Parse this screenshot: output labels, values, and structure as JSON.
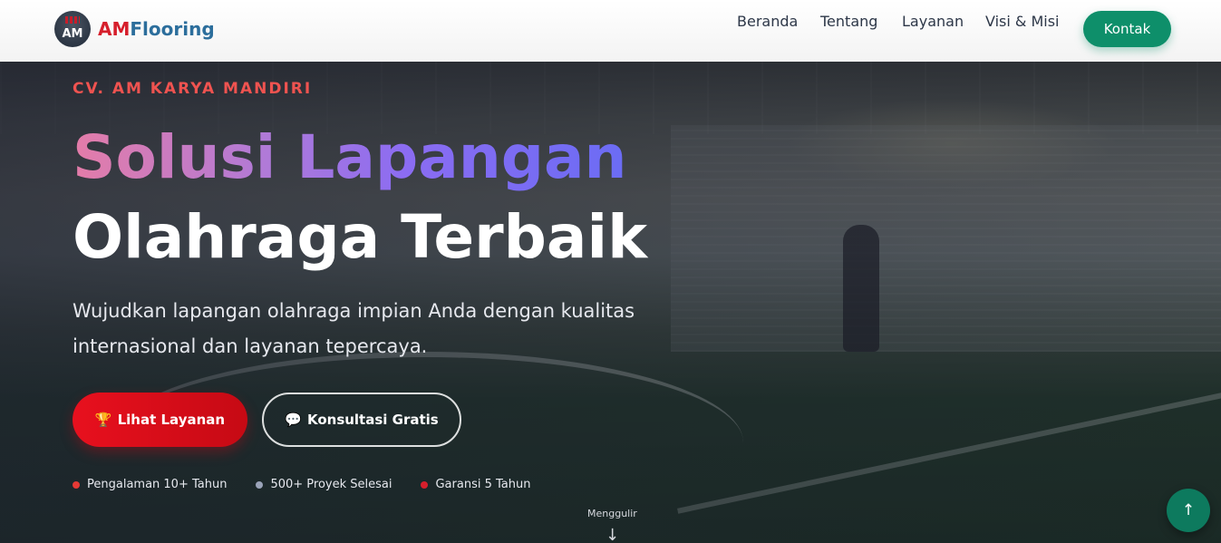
{
  "header": {
    "logo": {
      "badge_text": "AM",
      "name_part1": "AM",
      "name_part2": "Flooring"
    },
    "nav": [
      {
        "label": "Beranda"
      },
      {
        "label": "Tentang"
      },
      {
        "label": "Layanan"
      },
      {
        "label": "Visi & Misi"
      }
    ],
    "cta_label": "Kontak"
  },
  "hero": {
    "kicker": "CV. AM KARYA MANDIRI",
    "title_gradient": "Solusi Lapangan",
    "title_rest": " Olahraga Terbaik",
    "subtitle": "Wujudkan lapangan olahraga impian Anda dengan kualitas internasional dan layanan tepercaya.",
    "buttons": {
      "primary": {
        "icon": "trophy-icon",
        "glyph": "🏆",
        "label": "Lihat Layanan"
      },
      "secondary": {
        "icon": "chat-icon",
        "glyph": "💬",
        "label": "Konsultasi Gratis"
      }
    },
    "stats": [
      {
        "label": "Pengalaman 10+ Tahun",
        "dot_color": "#e53935"
      },
      {
        "label": "500+ Proyek Selesai",
        "dot_color": "#9aa3b8"
      },
      {
        "label": "Garansi 5 Tahun",
        "dot_color": "#d61f2c"
      }
    ],
    "scroll_label": "Menggulir",
    "scroll_arrow": "↓"
  },
  "back_to_top": {
    "icon": "arrow-up-icon",
    "glyph": "↑"
  },
  "colors": {
    "brand_red": "#d61f2c",
    "brand_blue": "#2c6e9c",
    "accent_green": "#0e8f6a",
    "kicker_red": "#ef5350"
  }
}
